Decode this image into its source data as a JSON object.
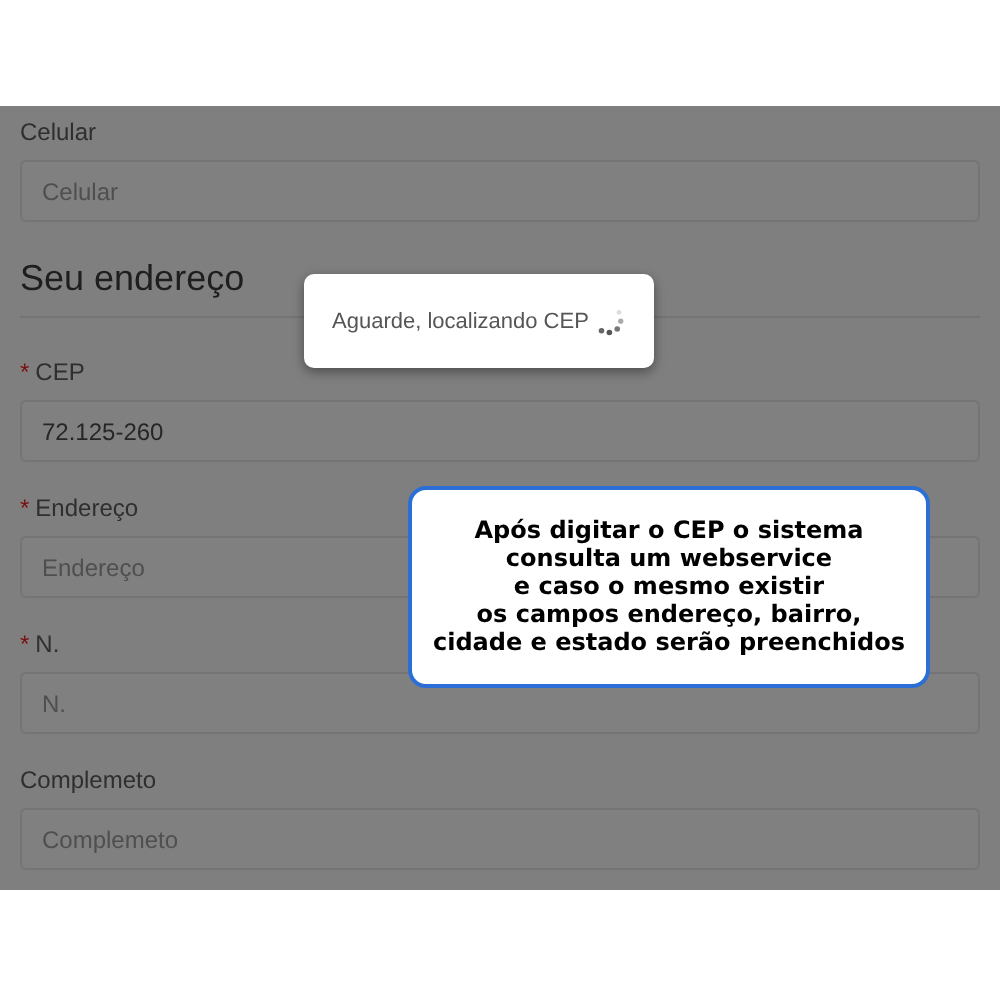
{
  "fields_top": [
    {
      "label": "Celular",
      "placeholder": "Celular"
    }
  ],
  "section": {
    "title": "Seu endereço"
  },
  "fields": [
    {
      "label": "CEP",
      "required_mark": "*",
      "value": "72.125-260"
    },
    {
      "label": "Endereço",
      "required_mark": "*",
      "placeholder": "Endereço"
    },
    {
      "label": "N.",
      "required_mark": "*",
      "placeholder": "N."
    },
    {
      "label": "Complemeto",
      "placeholder": "Complemeto"
    }
  ],
  "loading_dialog": {
    "message": "Aguarde, localizando CEP"
  },
  "callout": {
    "lines": [
      "Após digitar o CEP o sistema",
      "consulta um webservice",
      "e caso o mesmo existir",
      "os campos endereço, bairro,",
      "cidade e estado serão preenchidos"
    ]
  }
}
